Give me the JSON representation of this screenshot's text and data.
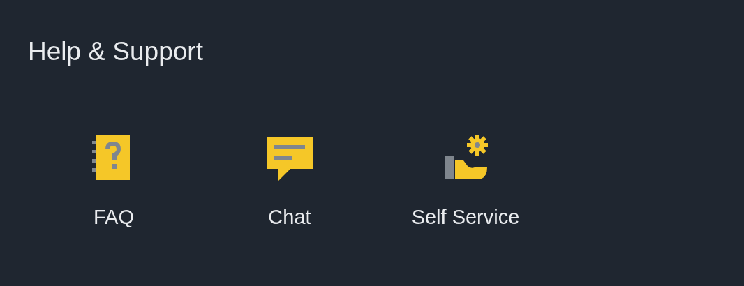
{
  "title": "Help & Support",
  "items": [
    {
      "kind": "faq",
      "label": "FAQ"
    },
    {
      "kind": "chat",
      "label": "Chat"
    },
    {
      "kind": "self_service",
      "label": "Self Service"
    }
  ]
}
